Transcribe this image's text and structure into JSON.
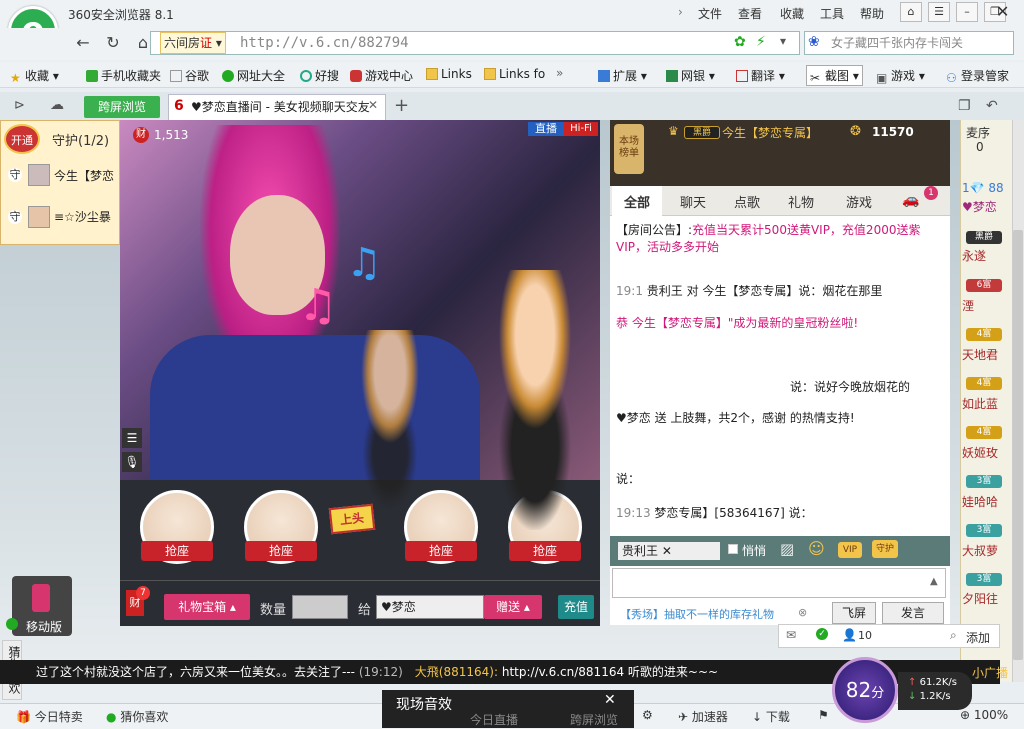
{
  "browser": {
    "title": "360安全浏览器 8.1",
    "menu": [
      "文件",
      "查看",
      "收藏",
      "工具",
      "帮助"
    ],
    "site_badge": "六间房",
    "cert_label": "证",
    "url": "http://v.6.cn/882794",
    "search_placeholder": "女子藏四千张内存卡闯关"
  },
  "bookmarks": [
    {
      "label": "收藏",
      "icon": "star-icon"
    },
    {
      "label": "手机收藏夹",
      "icon": "phone-icon"
    },
    {
      "label": "谷歌",
      "icon": "page-icon"
    },
    {
      "label": "网址大全",
      "icon": "plus-globe-icon"
    },
    {
      "label": "好搜",
      "icon": "search-icon"
    },
    {
      "label": "游戏中心",
      "icon": "gamepad-icon"
    },
    {
      "label": "Links",
      "icon": "folder-icon"
    },
    {
      "label": "Links fo",
      "icon": "folder-icon"
    }
  ],
  "bookmarks_right": [
    "扩展",
    "网银",
    "翻译",
    "截图",
    "游戏",
    "登录管家"
  ],
  "tabs": {
    "split_label": "跨屏浏览",
    "active_title": "♥梦恋直播间 - 美女视频聊天交友"
  },
  "left_panel": {
    "badge": "开通",
    "title": "守护(1/2)",
    "guards": [
      {
        "prefix": "守",
        "name": "今生【梦恋"
      },
      {
        "prefix": "守",
        "name": "≡☆沙尘暴"
      }
    ],
    "mobile_label": "移动版",
    "guess_label": "猜你喜欢"
  },
  "stage": {
    "wealth_label": "财",
    "count": "1,513",
    "live_label": "直播",
    "hifi_label": "Hi-Fi",
    "seat_label": "抢座",
    "seat_top_sign": "上头"
  },
  "gift_bar": {
    "wealth_label": "财",
    "wealth_count": "7",
    "treasure_label": "礼物宝箱",
    "qty_label": "数量",
    "to_label": "给",
    "target": "♥梦恋",
    "send_label": "赠送",
    "recharge_label": "充值"
  },
  "chat": {
    "rank_label_1": "本场",
    "rank_label_2": "榜单",
    "vip_name": "今生【梦恋专属】",
    "vip_badge": "黑爵",
    "vip_score": "11570",
    "tabs": [
      "全部",
      "聊天",
      "点歌",
      "礼物",
      "游戏"
    ],
    "car_count": "1",
    "announcement_prefix": "【房间公告】:",
    "announcement": "充值当天累计500送黄VIP，充值2000送紫VIP，活动多多开始",
    "lines": [
      {
        "time": "19:1",
        "text": "贵利王 对 今生【梦恋专属】说：烟花在那里"
      },
      {
        "time": "恭",
        "text": "今生【梦恋专属】\"成为最新的皇冠粉丝啦!"
      },
      {
        "time": "",
        "text": "说：说好今晚放烟花的"
      },
      {
        "time": "",
        "text": "♥梦恋 送 上肢舞，共2个，感谢 的热情支持!"
      },
      {
        "time": "说：",
        "text": ""
      },
      {
        "time": "19:13",
        "text": "梦恋专属】[58364167] 说："
      }
    ],
    "target_user": "贵利王",
    "quiet_label": "悄悄",
    "fly_label": "飞屏",
    "speak_label": "发言",
    "promo": "【秀场】抽取不一样的库存礼物"
  },
  "right_list": {
    "header": "麦序",
    "count": "0",
    "items": [
      {
        "badge": "1",
        "name": "88",
        "sub": "♥梦恋",
        "color": "#3a7bd5"
      },
      {
        "badge": "黑爵",
        "name": "永遂",
        "color": "#333333"
      },
      {
        "badge": "6富",
        "name": "湮",
        "color": "#c23a3a"
      },
      {
        "badge": "4富",
        "name": "天地君",
        "color": "#d4a017"
      },
      {
        "badge": "4富",
        "name": "如此蓝",
        "color": "#d4a017"
      },
      {
        "badge": "4富",
        "name": "妖姬玫",
        "color": "#d4a017"
      },
      {
        "badge": "3富",
        "name": "娃哈哈",
        "color": "#3aa0a0"
      },
      {
        "badge": "3富",
        "name": "大叔萝",
        "color": "#3aa0a0"
      },
      {
        "badge": "3富",
        "name": "夕阳往",
        "color": "#3aa0a0"
      }
    ]
  },
  "social": {
    "count": "10",
    "add_label": "添加"
  },
  "marquee": {
    "text": "过了这个村就没这个店了，六房又来一位美女。。去关注了---",
    "time": "(19:12)",
    "user": "大飛(881164):",
    "link": "http://v.6.cn/881164 听歌的进来~~~",
    "right_label": "小广播"
  },
  "popup": {
    "title": "现场音效",
    "hidden_items": [
      "今日直播",
      "跨屏浏览"
    ]
  },
  "speed": {
    "score": "82",
    "unit": "分",
    "up": "61.2K/s",
    "down": "1.2K/s"
  },
  "statusbar": {
    "today_special": "今日特卖",
    "guess": "猜你喜欢",
    "accelerator": "加速器",
    "download": "下载",
    "zoom": "100%"
  }
}
